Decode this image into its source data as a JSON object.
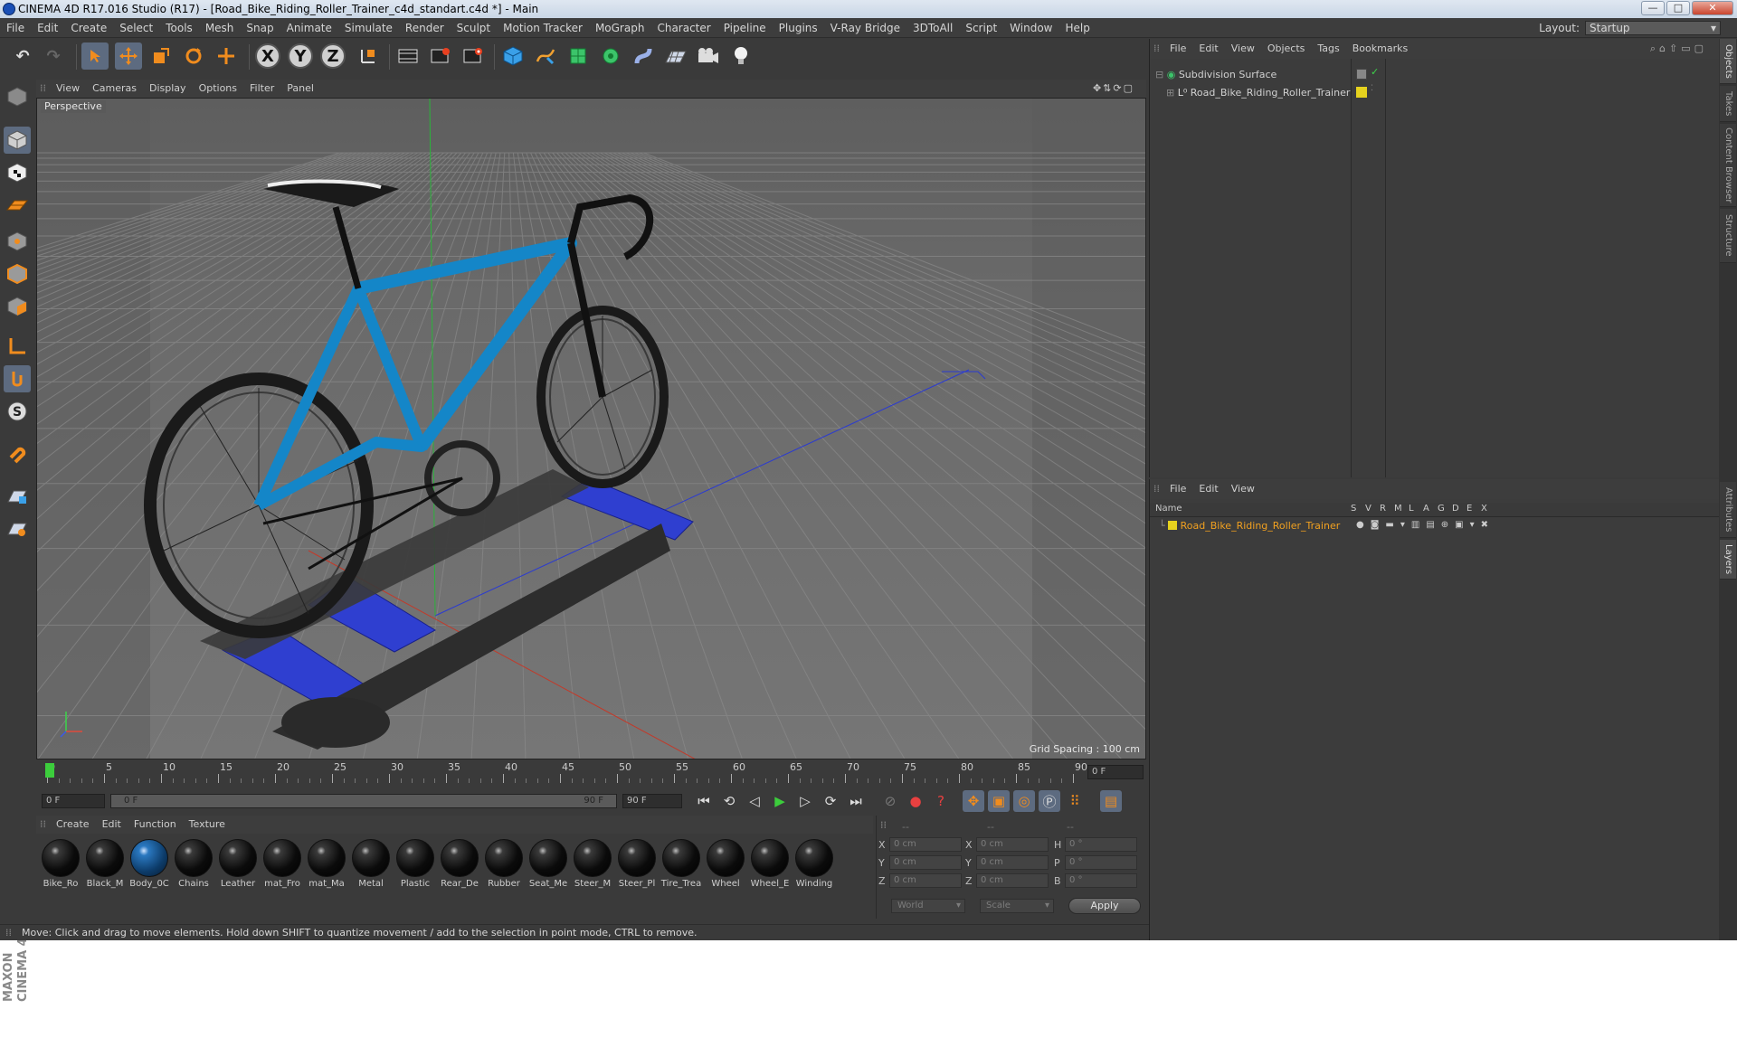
{
  "window": {
    "title": "CINEMA 4D R17.016 Studio (R17) - [Road_Bike_Riding_Roller_Trainer_c4d_standart.c4d *] - Main",
    "minimize": "—",
    "maximize": "□",
    "close": "✕"
  },
  "menubar": {
    "items": [
      "File",
      "Edit",
      "Create",
      "Select",
      "Tools",
      "Mesh",
      "Snap",
      "Animate",
      "Simulate",
      "Render",
      "Sculpt",
      "Motion Tracker",
      "MoGraph",
      "Character",
      "Pipeline",
      "Plugins",
      "V-Ray Bridge",
      "3DToAll",
      "Script",
      "Window",
      "Help"
    ],
    "layout_label": "Layout:",
    "layout_value": "Startup"
  },
  "toolbar": {
    "axis_x": "X",
    "axis_y": "Y",
    "axis_z": "Z"
  },
  "viewport": {
    "menu": [
      "View",
      "Cameras",
      "Display",
      "Options",
      "Filter",
      "Panel"
    ],
    "camera_label": "Perspective",
    "grid_spacing": "Grid Spacing : 100 cm"
  },
  "timeline": {
    "ticks": [
      "0",
      "5",
      "10",
      "15",
      "20",
      "25",
      "30",
      "35",
      "40",
      "45",
      "50",
      "55",
      "60",
      "65",
      "70",
      "75",
      "80",
      "85",
      "90"
    ],
    "current_frame": "0 F",
    "start_field": "0 F",
    "range_start": "0 F",
    "range_end": "90 F",
    "end_field": "90 F"
  },
  "materials": {
    "menu": [
      "Create",
      "Edit",
      "Function",
      "Texture"
    ],
    "items": [
      "Bike_Ro",
      "Black_M",
      "Body_0C",
      "Chains",
      "Leather",
      "mat_Fro",
      "mat_Ma",
      "Metal",
      "Plastic",
      "Rear_De",
      "Rubber",
      "Seat_Me",
      "Steer_M",
      "Steer_Pl",
      "Tire_Trea",
      "Wheel",
      "Wheel_E",
      "Winding"
    ]
  },
  "coords": {
    "header": [
      "--",
      "--",
      "--"
    ],
    "rows": [
      {
        "a": "X",
        "av": "0 cm",
        "b": "X",
        "bv": "0 cm",
        "c": "H",
        "cv": "0 °"
      },
      {
        "a": "Y",
        "av": "0 cm",
        "b": "Y",
        "bv": "0 cm",
        "c": "P",
        "cv": "0 °"
      },
      {
        "a": "Z",
        "av": "0 cm",
        "b": "Z",
        "bv": "0 cm",
        "c": "B",
        "cv": "0 °"
      }
    ],
    "space": "World",
    "mode": "Scale",
    "apply": "Apply"
  },
  "status": "Move: Click and drag to move elements. Hold down SHIFT to quantize movement / add to the selection in point mode, CTRL to remove.",
  "object_manager": {
    "menu": [
      "File",
      "Edit",
      "View",
      "Objects",
      "Tags",
      "Bookmarks"
    ],
    "objects": [
      "Subdivision Surface",
      "Road_Bike_Riding_Roller_Trainer"
    ]
  },
  "layer_manager": {
    "menu": [
      "File",
      "Edit",
      "View"
    ],
    "name_header": "Name",
    "columns": [
      "S",
      "V",
      "R",
      "M",
      "L",
      "A",
      "G",
      "D",
      "E",
      "X"
    ],
    "layer": "Road_Bike_Riding_Roller_Trainer",
    "layer_color": "#e6d21e"
  },
  "side_tabs": [
    "Objects",
    "Takes",
    "Content Browser",
    "Structure",
    "Attributes",
    "Layers"
  ],
  "brand": "MAXON CINEMA 4D"
}
